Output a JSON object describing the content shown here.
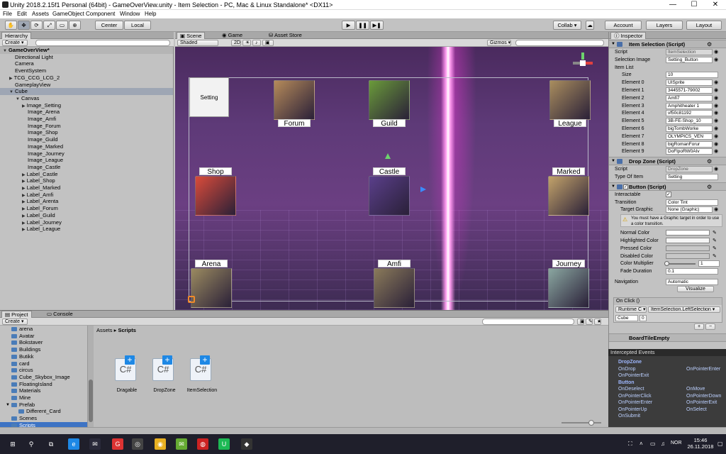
{
  "window": {
    "title": "Unity 2018.2.15f1 Personal (64bit) - GameOverView.unity - Item Selection - PC, Mac & Linux Standalone* <DX11>",
    "minimize": "—",
    "maximize": "☐",
    "close": "✕"
  },
  "menu": [
    "File",
    "Edit",
    "Assets",
    "GameObject",
    "Component",
    "Window",
    "Help"
  ],
  "toolbar": {
    "tools": [
      "✋",
      "✥",
      "⟳",
      "⤢",
      "▭",
      "⊕"
    ],
    "pivot": "Center",
    "space": "Local",
    "play": "▶",
    "pause": "❚❚",
    "step": "▶❚",
    "collab": "Collab ▾",
    "account": "Account",
    "layers": "Layers",
    "layout": "Layout"
  },
  "hierarchy": {
    "tab": "Hierarchy",
    "create": "Create ▾",
    "search_placeholder": "All",
    "items": [
      {
        "label": "GameOverView*",
        "indent": 0,
        "kind": "scene",
        "arrow": "▼"
      },
      {
        "label": "Directional Light",
        "indent": 1
      },
      {
        "label": "Camera",
        "indent": 1
      },
      {
        "label": "EventSystem",
        "indent": 1
      },
      {
        "label": "TCG_CCG_LCG_2",
        "indent": 1,
        "arrow": "▶"
      },
      {
        "label": "GameplayView",
        "indent": 1
      },
      {
        "label": "Cube",
        "indent": 1,
        "arrow": "▼",
        "selected": true
      },
      {
        "label": "Canvas",
        "indent": 2,
        "arrow": "▼"
      },
      {
        "label": "Image_Setting",
        "indent": 3,
        "arrow": "▶"
      },
      {
        "label": "Image_Arena",
        "indent": 3
      },
      {
        "label": "Image_Amfi",
        "indent": 3
      },
      {
        "label": "Image_Forum",
        "indent": 3
      },
      {
        "label": "Image_Shop",
        "indent": 3
      },
      {
        "label": "Image_Guild",
        "indent": 3
      },
      {
        "label": "Image_Marked",
        "indent": 3
      },
      {
        "label": "Image_Journey",
        "indent": 3
      },
      {
        "label": "Image_League",
        "indent": 3
      },
      {
        "label": "Image_Castle",
        "indent": 3
      },
      {
        "label": "Label_Castle",
        "indent": 3,
        "arrow": "▶"
      },
      {
        "label": "Label_Shop",
        "indent": 3,
        "arrow": "▶"
      },
      {
        "label": "Label_Marked",
        "indent": 3,
        "arrow": "▶"
      },
      {
        "label": "Label_Amfi",
        "indent": 3,
        "arrow": "▶"
      },
      {
        "label": "Label_Arenta",
        "indent": 3,
        "arrow": "▶"
      },
      {
        "label": "Label_Forum",
        "indent": 3,
        "arrow": "▶"
      },
      {
        "label": "Label_Guild",
        "indent": 3,
        "arrow": "▶"
      },
      {
        "label": "Label_Journey",
        "indent": 3,
        "arrow": "▶"
      },
      {
        "label": "Label_League",
        "indent": 3,
        "arrow": "▶"
      }
    ]
  },
  "scene": {
    "tabs": [
      "Scene",
      "Game",
      "Asset Store"
    ],
    "shading": "Shaded",
    "mode2d": "2D",
    "gizmos": "Gizmos ▾",
    "search_placeholder": "All",
    "setting_button": "Setting",
    "cards": [
      {
        "label": "Forum",
        "color": "#b58a5a"
      },
      {
        "label": "Guild",
        "color": "#6a9a3a"
      },
      {
        "label": "League",
        "color": "#a98d5e"
      },
      {
        "label": "Shop",
        "color": "#d94b3a"
      },
      {
        "label": "Castle",
        "color": "#5a3f8a"
      },
      {
        "label": "Marked",
        "color": "#c2a26a"
      },
      {
        "label": "Arena",
        "color": "#9a8a60"
      },
      {
        "label": "Amfi",
        "color": "#8a7a5a"
      },
      {
        "label": "Journey",
        "color": "#8aa6a0"
      }
    ]
  },
  "inspector": {
    "tab": "Inspector",
    "item_selection": {
      "header": "Item Selection (Script)",
      "script_label": "Script",
      "script_value": "ItemSelection",
      "selection_image_label": "Selection Image",
      "selection_image_value": "Setting_Button",
      "item_list_label": "Item List",
      "size_label": "Size",
      "size_value": "10",
      "elements": [
        {
          "label": "Element 0",
          "value": "UISprite"
        },
        {
          "label": "Element 1",
          "value": "3445571-79002"
        },
        {
          "label": "Element 2",
          "value": "Amfi7"
        },
        {
          "label": "Element 3",
          "value": "Amphitheater 1"
        },
        {
          "label": "Element 4",
          "value": "vf50c81192"
        },
        {
          "label": "Element 5",
          "value": "3B-FE-Shop_10"
        },
        {
          "label": "Element 6",
          "value": "bigTombWorke"
        },
        {
          "label": "Element 7",
          "value": "OLYMPICS_VEN"
        },
        {
          "label": "Element 8",
          "value": "bigRomanForur"
        },
        {
          "label": "Element 9",
          "value": "DoFlpoRW0AIv"
        }
      ]
    },
    "drop_zone": {
      "header": "Drop Zone (Script)",
      "script_label": "Script",
      "script_value": "DropZone",
      "type_label": "Type Of Item",
      "type_value": "Setting"
    },
    "button": {
      "header": "Button (Script)",
      "interactable_label": "Interactable",
      "transition_label": "Transition",
      "transition_value": "Color Tint",
      "target_graphic_label": "Target Graphic",
      "target_graphic_value": "None (Graphic)",
      "warning": "You must have a Graphic target in order to use a color transition.",
      "colors": [
        {
          "label": "Normal Color",
          "value": "#ffffff"
        },
        {
          "label": "Highlighted Color",
          "value": "#f5f5f5"
        },
        {
          "label": "Pressed Color",
          "value": "#c8c8c8"
        },
        {
          "label": "Disabled Color",
          "value": "#c8c8c8"
        }
      ],
      "multiplier_label": "Color Multiplier",
      "multiplier_value": "1",
      "fade_label": "Fade Duration",
      "fade_value": "0.1",
      "navigation_label": "Navigation",
      "navigation_value": "Automatic",
      "visualize": "Visualize",
      "onclick_label": "On Click ()",
      "runtime": "Runtime C ▾",
      "function": "ItemSelection.LeftSelection ▾",
      "object": "Cube",
      "object_value": "0",
      "add": "+",
      "remove": "−"
    },
    "next_component": "BoardTileEmpty"
  },
  "events": {
    "header": "Intercepted Events",
    "groups": [
      {
        "title": "DropZone",
        "items": [
          "OnDrop",
          "OnPointerEnter",
          "OnPointerExit"
        ]
      },
      {
        "title": "Button",
        "items": [
          "OnDeselect",
          "OnMove",
          "OnPointerClick",
          "OnPointerDown",
          "OnPointerEnter",
          "OnPointerExit",
          "OnPointerUp",
          "OnSelect",
          "OnSubmit"
        ]
      }
    ]
  },
  "project": {
    "tabs": [
      "Project",
      "Console"
    ],
    "create": "Create ▾",
    "search_placeholder": "",
    "folders": [
      "arena",
      "Avatar",
      "Bokstaver",
      "Buildings",
      "Butikk",
      "card",
      "circus",
      "Cube_Skybox_Image",
      "FloatingIsland",
      "Materials",
      "Mine",
      "Prefab",
      "Different_Card",
      "Scenes",
      "Scripts"
    ],
    "breadcrumb": [
      "Assets",
      "Scripts"
    ],
    "assets": [
      {
        "label": "Dragable",
        "icon": "C#"
      },
      {
        "label": "DropZone",
        "icon": "C#"
      },
      {
        "label": "ItemSelection",
        "icon": "C#"
      }
    ]
  },
  "taskbar": {
    "time": "15:46",
    "date": "26.11.2018",
    "lang": "NOR",
    "icons": [
      "⊞",
      "⚲",
      "⧉",
      "e",
      "✉",
      "G",
      "◎",
      "◉",
      "✉",
      "◍",
      "U",
      "◆"
    ]
  }
}
